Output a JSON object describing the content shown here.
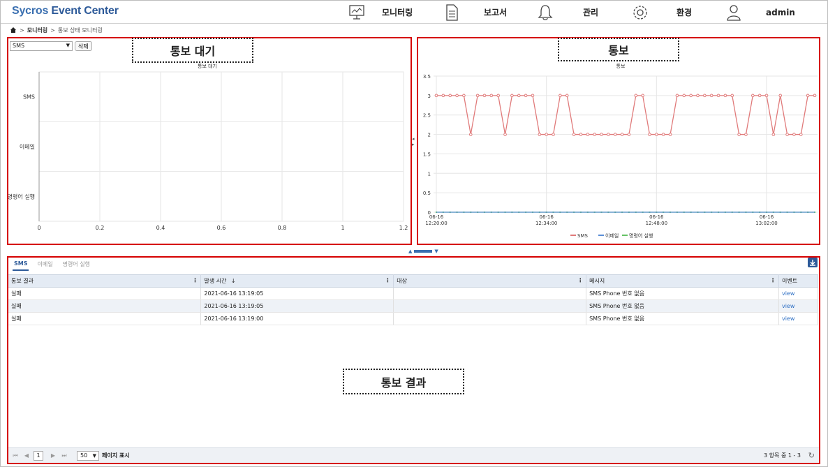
{
  "app": {
    "logo_main": "Sycros",
    "logo_sub": "Event Center"
  },
  "nav": [
    {
      "label": "모니터링",
      "icon": "monitor-icon"
    },
    {
      "label": "보고서",
      "icon": "document-icon"
    },
    {
      "label": "관리",
      "icon": "bell-icon"
    },
    {
      "label": "환경",
      "icon": "gear-icon"
    },
    {
      "label": "admin",
      "icon": "user-icon"
    }
  ],
  "breadcrumb": {
    "level1": "모니터링",
    "level2": "통보 상태 모니터링"
  },
  "waiting_panel": {
    "select_value": "SMS",
    "delete_label": "삭제",
    "callout": "통보 대기"
  },
  "notify_panel": {
    "callout": "통보"
  },
  "result_panel": {
    "callout": "통보 결과",
    "tabs": [
      "SMS",
      "이메일",
      "명령어 실행"
    ],
    "columns": [
      "통보 결과",
      "발생 시간",
      "대상",
      "메시지",
      "이벤트"
    ],
    "sort_arrow": "↓",
    "rows": [
      {
        "result": "실패",
        "time": "2021-06-16 13:19:05",
        "target": "",
        "message": "SMS Phone 번호 없음",
        "event": "view"
      },
      {
        "result": "실패",
        "time": "2021-06-16 13:19:05",
        "target": "",
        "message": "SMS Phone 번호 없음",
        "event": "view"
      },
      {
        "result": "실패",
        "time": "2021-06-16 13:19:00",
        "target": "",
        "message": "SMS Phone 번호 없음",
        "event": "view"
      }
    ],
    "pager": {
      "page": "1",
      "page_size": "50",
      "page_size_label": "페이지 표시",
      "count_text": "3 항목 중 1 - 3"
    }
  },
  "colors": {
    "accent": "#2d5a99",
    "highlight_border": "#d60000",
    "sms_series": "#e07a7a",
    "email_series": "#5b8fd6",
    "cmd_series": "#66c266"
  },
  "chart_data": [
    {
      "type": "bar",
      "title": "통보 대기",
      "categories": [
        "SMS",
        "이메일",
        "명령어 실행"
      ],
      "values": [
        0,
        0,
        0
      ],
      "xticks": [
        "0",
        "0.2",
        "0.4",
        "0.6",
        "0.8",
        "1",
        "1.2"
      ],
      "xlim": [
        0,
        1.2
      ],
      "orientation": "horizontal",
      "grid": true
    },
    {
      "type": "line",
      "title": "통보",
      "yticks": [
        "0",
        "0.5",
        "1",
        "1.5",
        "2",
        "2.5",
        "3",
        "3.5"
      ],
      "ylim": [
        0,
        3.5
      ],
      "xticks": [
        {
          "line1": "06-16",
          "line2": "12:20:00"
        },
        {
          "line1": "06-16",
          "line2": "12:34:00"
        },
        {
          "line1": "06-16",
          "line2": "12:48:00"
        },
        {
          "line1": "06-16",
          "line2": "13:02:00"
        }
      ],
      "legend": [
        "SMS",
        "이메일",
        "명령어 실행"
      ],
      "legend_position": "bottom",
      "series": [
        {
          "name": "SMS",
          "values": [
            3,
            3,
            3,
            3,
            3,
            2,
            3,
            3,
            3,
            3,
            2,
            3,
            3,
            3,
            3,
            2,
            2,
            2,
            3,
            3,
            2,
            2,
            2,
            2,
            2,
            2,
            2,
            2,
            2,
            3,
            3,
            2,
            2,
            2,
            2,
            3,
            3,
            3,
            3,
            3,
            3,
            3,
            3,
            3,
            2,
            2,
            3,
            3,
            3,
            2,
            3,
            2,
            2,
            2,
            3,
            3
          ]
        },
        {
          "name": "이메일",
          "values": [
            0,
            0,
            0,
            0,
            0,
            0,
            0,
            0,
            0,
            0,
            0,
            0,
            0,
            0,
            0,
            0,
            0,
            0,
            0,
            0,
            0,
            0,
            0,
            0,
            0,
            0,
            0,
            0,
            0,
            0,
            0,
            0,
            0,
            0,
            0,
            0,
            0,
            0,
            0,
            0,
            0,
            0,
            0,
            0,
            0,
            0,
            0,
            0,
            0,
            0,
            0,
            0,
            0,
            0,
            0,
            0
          ]
        },
        {
          "name": "명령어 실행",
          "values": [
            0,
            0,
            0,
            0,
            0,
            0,
            0,
            0,
            0,
            0,
            0,
            0,
            0,
            0,
            0,
            0,
            0,
            0,
            0,
            0,
            0,
            0,
            0,
            0,
            0,
            0,
            0,
            0,
            0,
            0,
            0,
            0,
            0,
            0,
            0,
            0,
            0,
            0,
            0,
            0,
            0,
            0,
            0,
            0,
            0,
            0,
            0,
            0,
            0,
            0,
            0,
            0,
            0,
            0,
            0,
            0
          ]
        }
      ]
    }
  ]
}
